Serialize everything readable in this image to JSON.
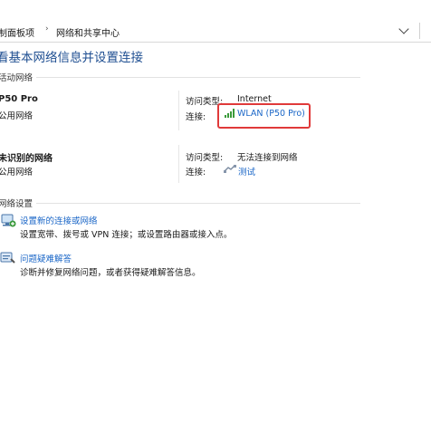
{
  "address_bar": {
    "crumb_control_panel": "制面板项",
    "crumb_network_center": "网络和共享中心"
  },
  "page_title": "看基本网络信息并设置连接",
  "active_networks": {
    "section_label": "活动网络",
    "networks": [
      {
        "name": "P50 Pro",
        "type": "公用网络",
        "access_type_label": "访问类型:",
        "access_type_value": "Internet",
        "connection_label": "连接:",
        "connection_value": "WLAN (P50 Pro)"
      },
      {
        "name": "未识别的网络",
        "type": "公用网络",
        "access_type_label": "访问类型:",
        "access_type_value": "无法连接到网络",
        "connection_label": "连接:",
        "connection_value": "测试"
      }
    ]
  },
  "change_settings": {
    "section_label": "网络设置",
    "tasks": [
      {
        "link": "设置新的连接或网络",
        "desc": "设置宽带、拨号或 VPN 连接；或设置路由器或接入点。",
        "icon": "new-connection-icon"
      },
      {
        "link": "问题疑难解答",
        "desc": "诊断并修复网络问题，或者获得疑难解答信息。",
        "icon": "troubleshoot-icon"
      }
    ]
  },
  "colors": {
    "title_blue": "#1e4e91",
    "link_blue": "#1a66c7",
    "highlight_red": "#e03a3a",
    "wifi_green": "#3a9a3a"
  }
}
